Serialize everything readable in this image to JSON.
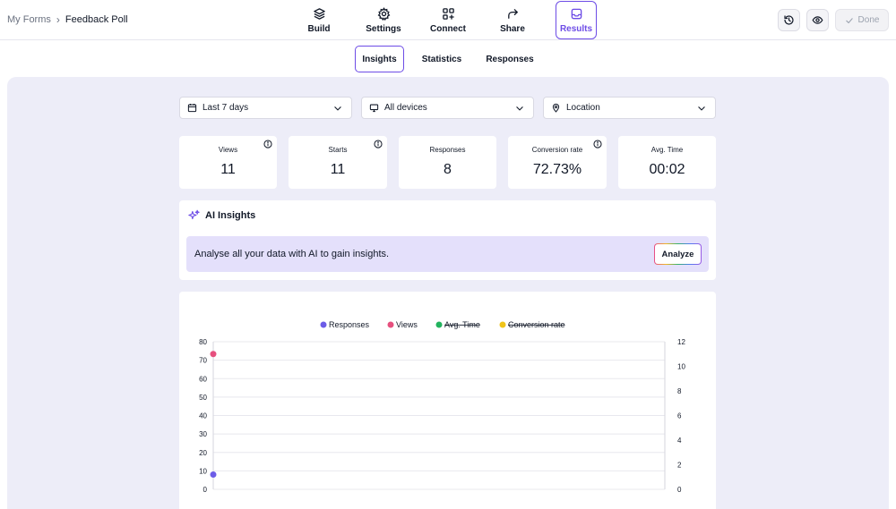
{
  "breadcrumb": {
    "root": "My Forms",
    "separator": "›",
    "current": "Feedback Poll"
  },
  "nav_tabs": [
    {
      "label": "Build",
      "icon": "layers-icon"
    },
    {
      "label": "Settings",
      "icon": "gear-icon"
    },
    {
      "label": "Connect",
      "icon": "grid-plus-icon"
    },
    {
      "label": "Share",
      "icon": "share-arrow-icon"
    },
    {
      "label": "Results",
      "icon": "inbox-icon",
      "active": true
    }
  ],
  "actions": {
    "history_icon": "history-icon",
    "preview_icon": "eye-icon",
    "done_label": "Done"
  },
  "sub_tabs": [
    {
      "label": "Insights",
      "active": true
    },
    {
      "label": "Statistics"
    },
    {
      "label": "Responses"
    }
  ],
  "filters": {
    "date": {
      "label": "Last 7 days",
      "icon": "calendar-icon"
    },
    "device": {
      "label": "All devices",
      "icon": "monitor-icon"
    },
    "location": {
      "label": "Location",
      "icon": "location-pin-icon"
    }
  },
  "stats": [
    {
      "label": "Views",
      "value": "11",
      "info": true
    },
    {
      "label": "Starts",
      "value": "11",
      "info": true
    },
    {
      "label": "Responses",
      "value": "8",
      "info": false
    },
    {
      "label": "Conversion rate",
      "value": "72.73%",
      "info": true
    },
    {
      "label": "Avg. Time",
      "value": "00:02",
      "info": false
    }
  ],
  "ai_insights": {
    "title": "AI Insights",
    "message": "Analyse all your data with AI to gain insights.",
    "button_label": "Analyze"
  },
  "colors": {
    "accent": "#6d4ce6",
    "responses": "#6c5ce7",
    "views": "#e6507e",
    "avg_time": "#22b35e",
    "conversion": "#f0c419"
  },
  "chart_data": {
    "type": "scatter",
    "legend": [
      {
        "name": "Responses",
        "color": "#6c5ce7",
        "hidden": false
      },
      {
        "name": "Views",
        "color": "#e6507e",
        "hidden": false
      },
      {
        "name": "Avg. Time",
        "color": "#22b35e",
        "hidden": true
      },
      {
        "name": "Conversion rate",
        "color": "#f0c419",
        "hidden": true
      }
    ],
    "y_left_ticks": [
      0,
      10,
      20,
      30,
      40,
      50,
      60,
      70,
      80
    ],
    "y_left_range": [
      0,
      80
    ],
    "y_right_ticks": [
      0,
      2,
      4,
      6,
      8,
      10,
      12
    ],
    "y_right_range": [
      0,
      12
    ],
    "grid": true,
    "legend_placement": "top-center",
    "series": [
      {
        "name": "Responses",
        "axis": "left",
        "values": [
          8
        ]
      },
      {
        "name": "Views",
        "axis": "right",
        "values": [
          11
        ]
      }
    ]
  }
}
